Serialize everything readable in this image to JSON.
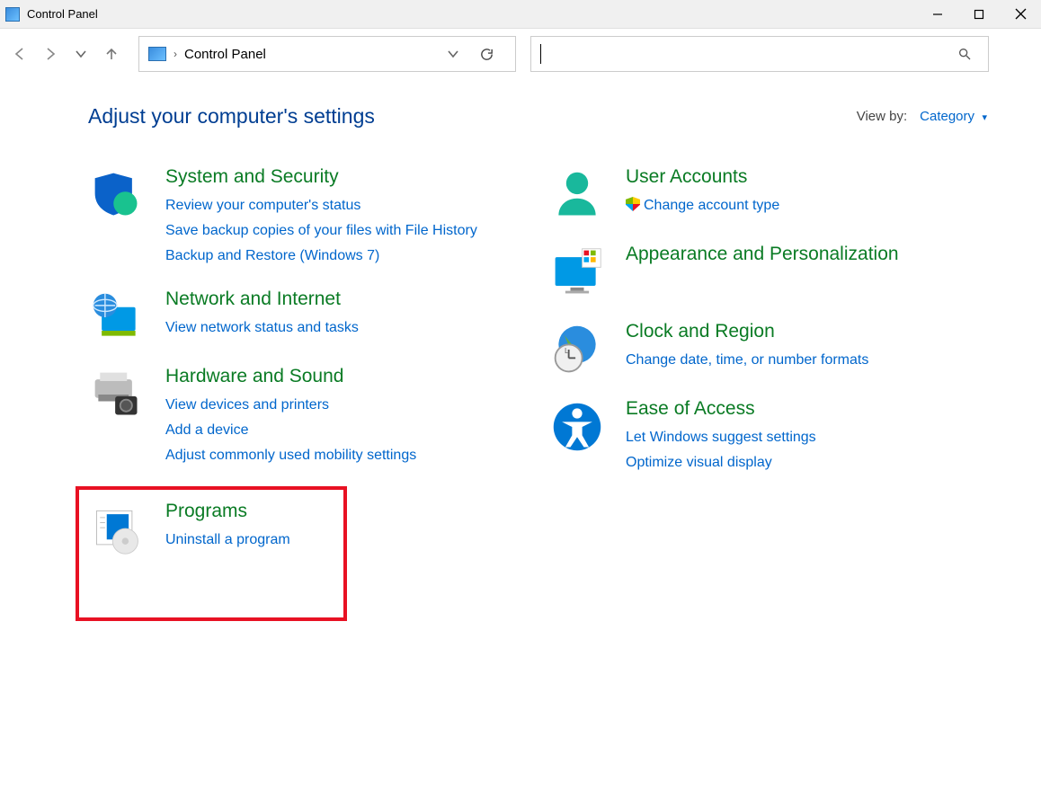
{
  "window": {
    "title": "Control Panel"
  },
  "address": {
    "location": "Control Panel"
  },
  "search": {
    "placeholder": ""
  },
  "page": {
    "heading": "Adjust your computer's settings",
    "viewby_label": "View by:",
    "viewby_value": "Category"
  },
  "left_categories": [
    {
      "title": "System and Security",
      "links": [
        "Review your computer's status",
        "Save backup copies of your files with File History",
        "Backup and Restore (Windows 7)"
      ],
      "highlight": false
    },
    {
      "title": "Network and Internet",
      "links": [
        "View network status and tasks"
      ],
      "highlight": false
    },
    {
      "title": "Hardware and Sound",
      "links": [
        "View devices and printers",
        "Add a device",
        "Adjust commonly used mobility settings"
      ],
      "highlight": false
    },
    {
      "title": "Programs",
      "links": [
        "Uninstall a program"
      ],
      "highlight": true
    }
  ],
  "right_categories": [
    {
      "title": "User Accounts",
      "links": [
        "Change account type"
      ],
      "shield_on_first": true
    },
    {
      "title": "Appearance and Personalization",
      "links": []
    },
    {
      "title": "Clock and Region",
      "links": [
        "Change date, time, or number formats"
      ]
    },
    {
      "title": "Ease of Access",
      "links": [
        "Let Windows suggest settings",
        "Optimize visual display"
      ]
    }
  ]
}
